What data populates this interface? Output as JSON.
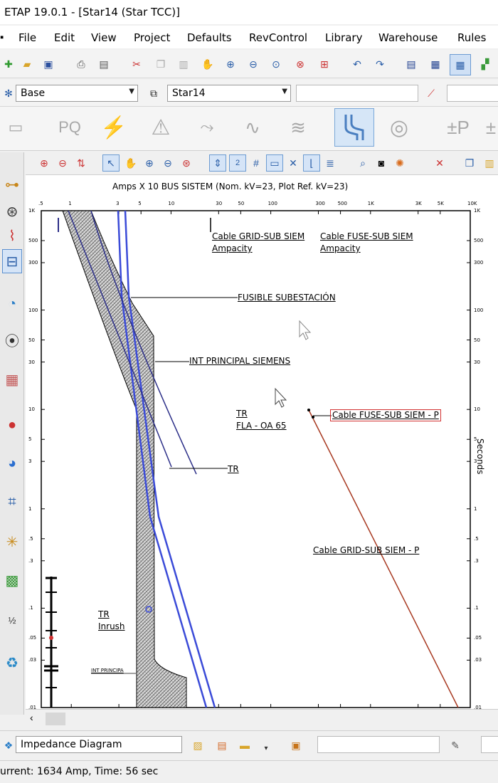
{
  "window": {
    "title": "ETAP 19.0.1  - [Star14 (Star TCC)]"
  },
  "menu": [
    "File",
    "Edit",
    "View",
    "Project",
    "Defaults",
    "RevControl",
    "Library",
    "Warehouse",
    "Rules"
  ],
  "toolbar2": {
    "presentation_value": "Base",
    "config_value": "Star14"
  },
  "tcc": {
    "header": "Amps  X  10   BUS SISTEM (Nom. kV=23, Plot Ref. kV=23)",
    "x_ticks": [
      ".5",
      "1",
      "3",
      "5",
      "10",
      "30",
      "50",
      "100",
      "300",
      "500",
      "1K",
      "3K",
      "5K",
      "10K"
    ],
    "y_ticks": [
      "1K",
      "500",
      "300",
      "100",
      "50",
      "30",
      "10",
      "5",
      "3",
      "1",
      ".5",
      ".3",
      ".1",
      ".05",
      ".03",
      ".01"
    ],
    "y_axis_label": "Seconds",
    "labels": {
      "cable_grid_sub": "Cable GRID-SUB SIEM",
      "cable_grid_sub_ampacity": "Ampacity",
      "cable_fuse_sub": "Cable FUSE-SUB SIEM",
      "cable_fuse_sub_ampacity": "Ampacity",
      "fusible": "FUSIBLE SUBESTACIÓN",
      "int_principal": "INT PRINCIPAL SIEMENS",
      "tr_fla_1": "TR",
      "tr_fla_2": "FLA - OA 65",
      "cable_fuse_p": "Cable FUSE-SUB SIEM - P",
      "tr": "TR",
      "cable_grid_p": "Cable GRID-SUB SIEM - P",
      "tr_inrush_1": "TR",
      "tr_inrush_2": "Inrush",
      "int_principal_small": "INT PRINCIPA"
    }
  },
  "bottom": {
    "diagram_name": "Impedance Diagram"
  },
  "status": {
    "text": "urrent: 1634 Amp, Time: 56 sec"
  },
  "colors": {
    "fuse_curve": "#3b4bd8",
    "cable_fuse_curve": "#a83a22",
    "navy_line": "#2c2f88",
    "label_box_border": "#d23030"
  }
}
